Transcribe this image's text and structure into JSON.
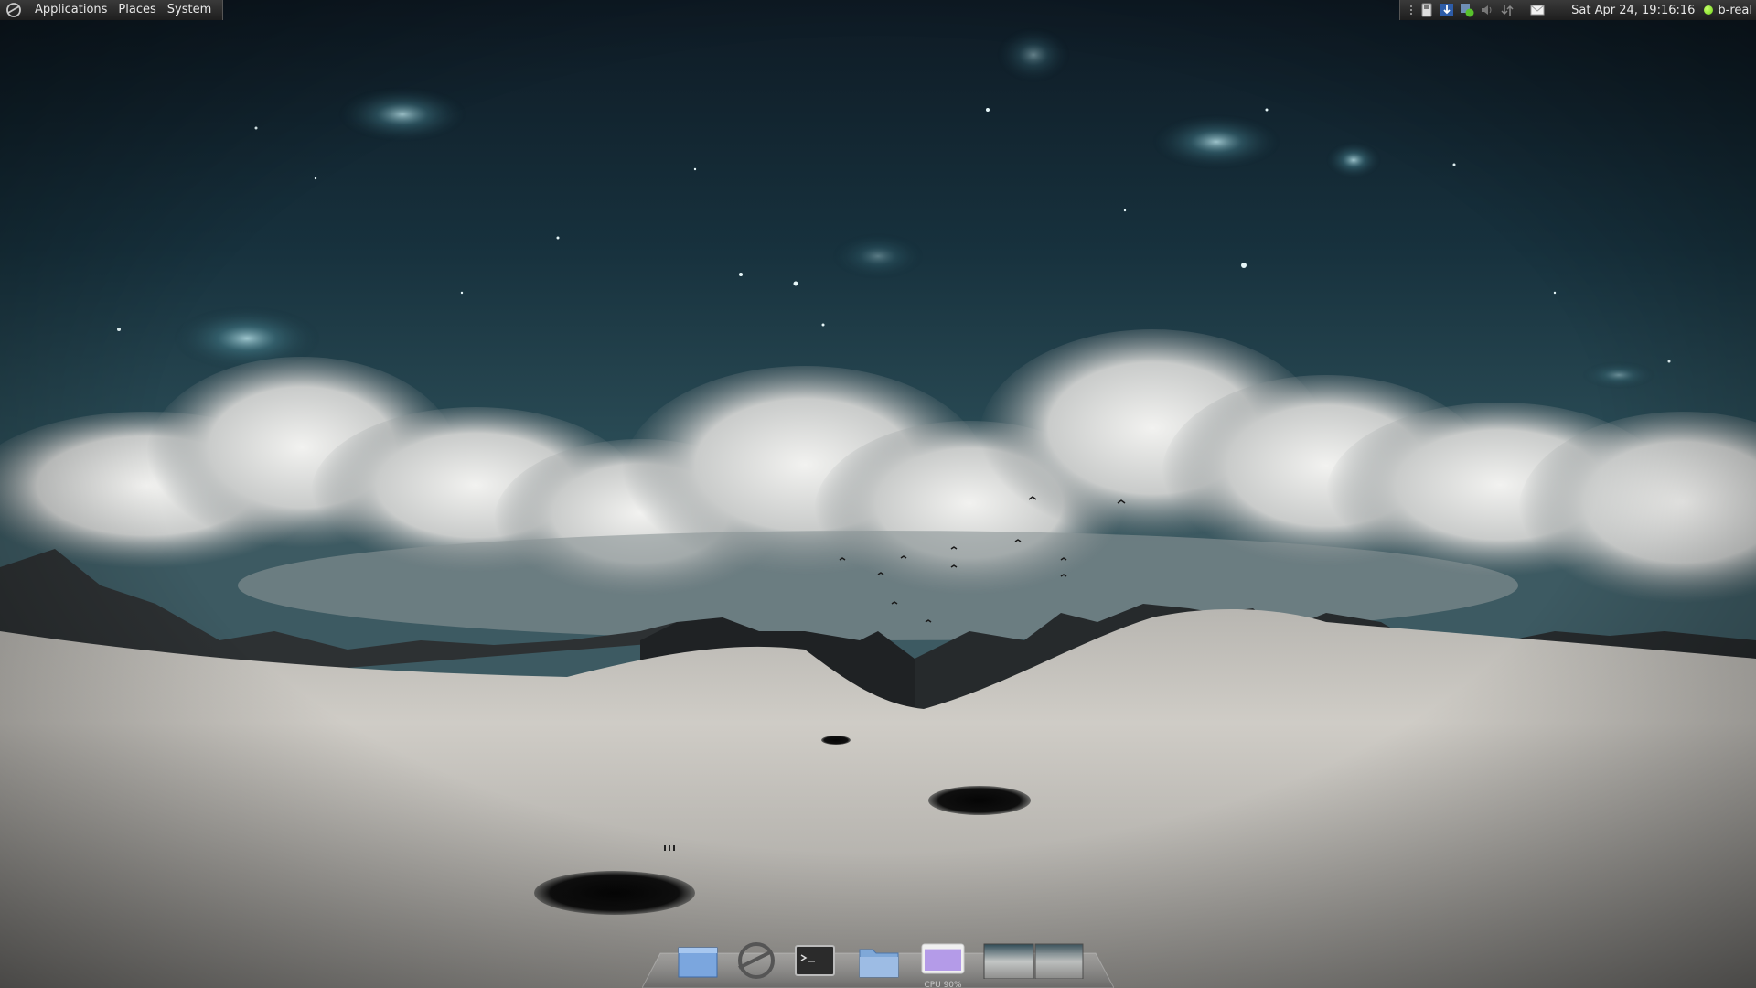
{
  "top_panel": {
    "menus": {
      "applications": "Applications",
      "places": "Places",
      "system": "System"
    },
    "tray": {
      "icons": [
        "separator-dots-icon",
        "removable-drive-icon",
        "download-arrow-icon",
        "chat-status-icon",
        "volume-icon",
        "network-icon",
        "mail-icon"
      ],
      "clock": "Sat Apr 24, 19:16:16",
      "user": "b-real",
      "status_color": "#6fd21a"
    }
  },
  "dock": {
    "items": [
      "window-icon",
      "browser-e-icon",
      "terminal-icon",
      "folder-icon",
      "cpu-monitor-icon",
      "workspace-switcher"
    ],
    "cpu_label": "CPU 90%",
    "cpu_fill_percent": 90
  },
  "colors": {
    "panel_bg": "#2a2a2a",
    "panel_text": "#e8e8e8",
    "cpu_fill": "#b49be8"
  }
}
